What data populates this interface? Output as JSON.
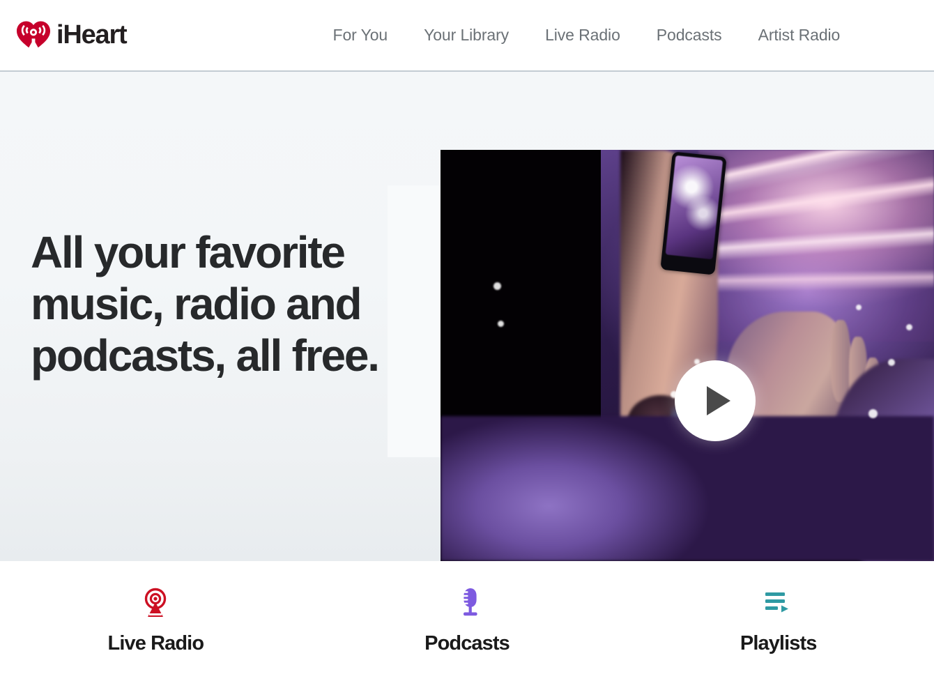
{
  "header": {
    "logo": {
      "icon": "iheart-logo-icon",
      "text": "iHeart",
      "color": "#c6002b"
    },
    "nav": [
      {
        "label": "For You"
      },
      {
        "label": "Your Library"
      },
      {
        "label": "Live Radio"
      },
      {
        "label": "Podcasts"
      },
      {
        "label": "Artist Radio"
      }
    ]
  },
  "hero": {
    "title_line1": "All your favorite",
    "title_line2": "music, radio and",
    "title_line3": "podcasts, all free.",
    "video": {
      "name": "hero-video",
      "play_icon": "play-icon",
      "description": "Concert crowd with raised arms holding a phone under purple stage lights"
    }
  },
  "features": [
    {
      "icon": "live-radio-tower-icon",
      "label": "Live Radio",
      "color": "#cc1023"
    },
    {
      "icon": "podcast-microphone-icon",
      "label": "Podcasts",
      "color": "#7d5ae0"
    },
    {
      "icon": "playlist-icon",
      "label": "Playlists",
      "color": "#2f9aa3"
    }
  ]
}
